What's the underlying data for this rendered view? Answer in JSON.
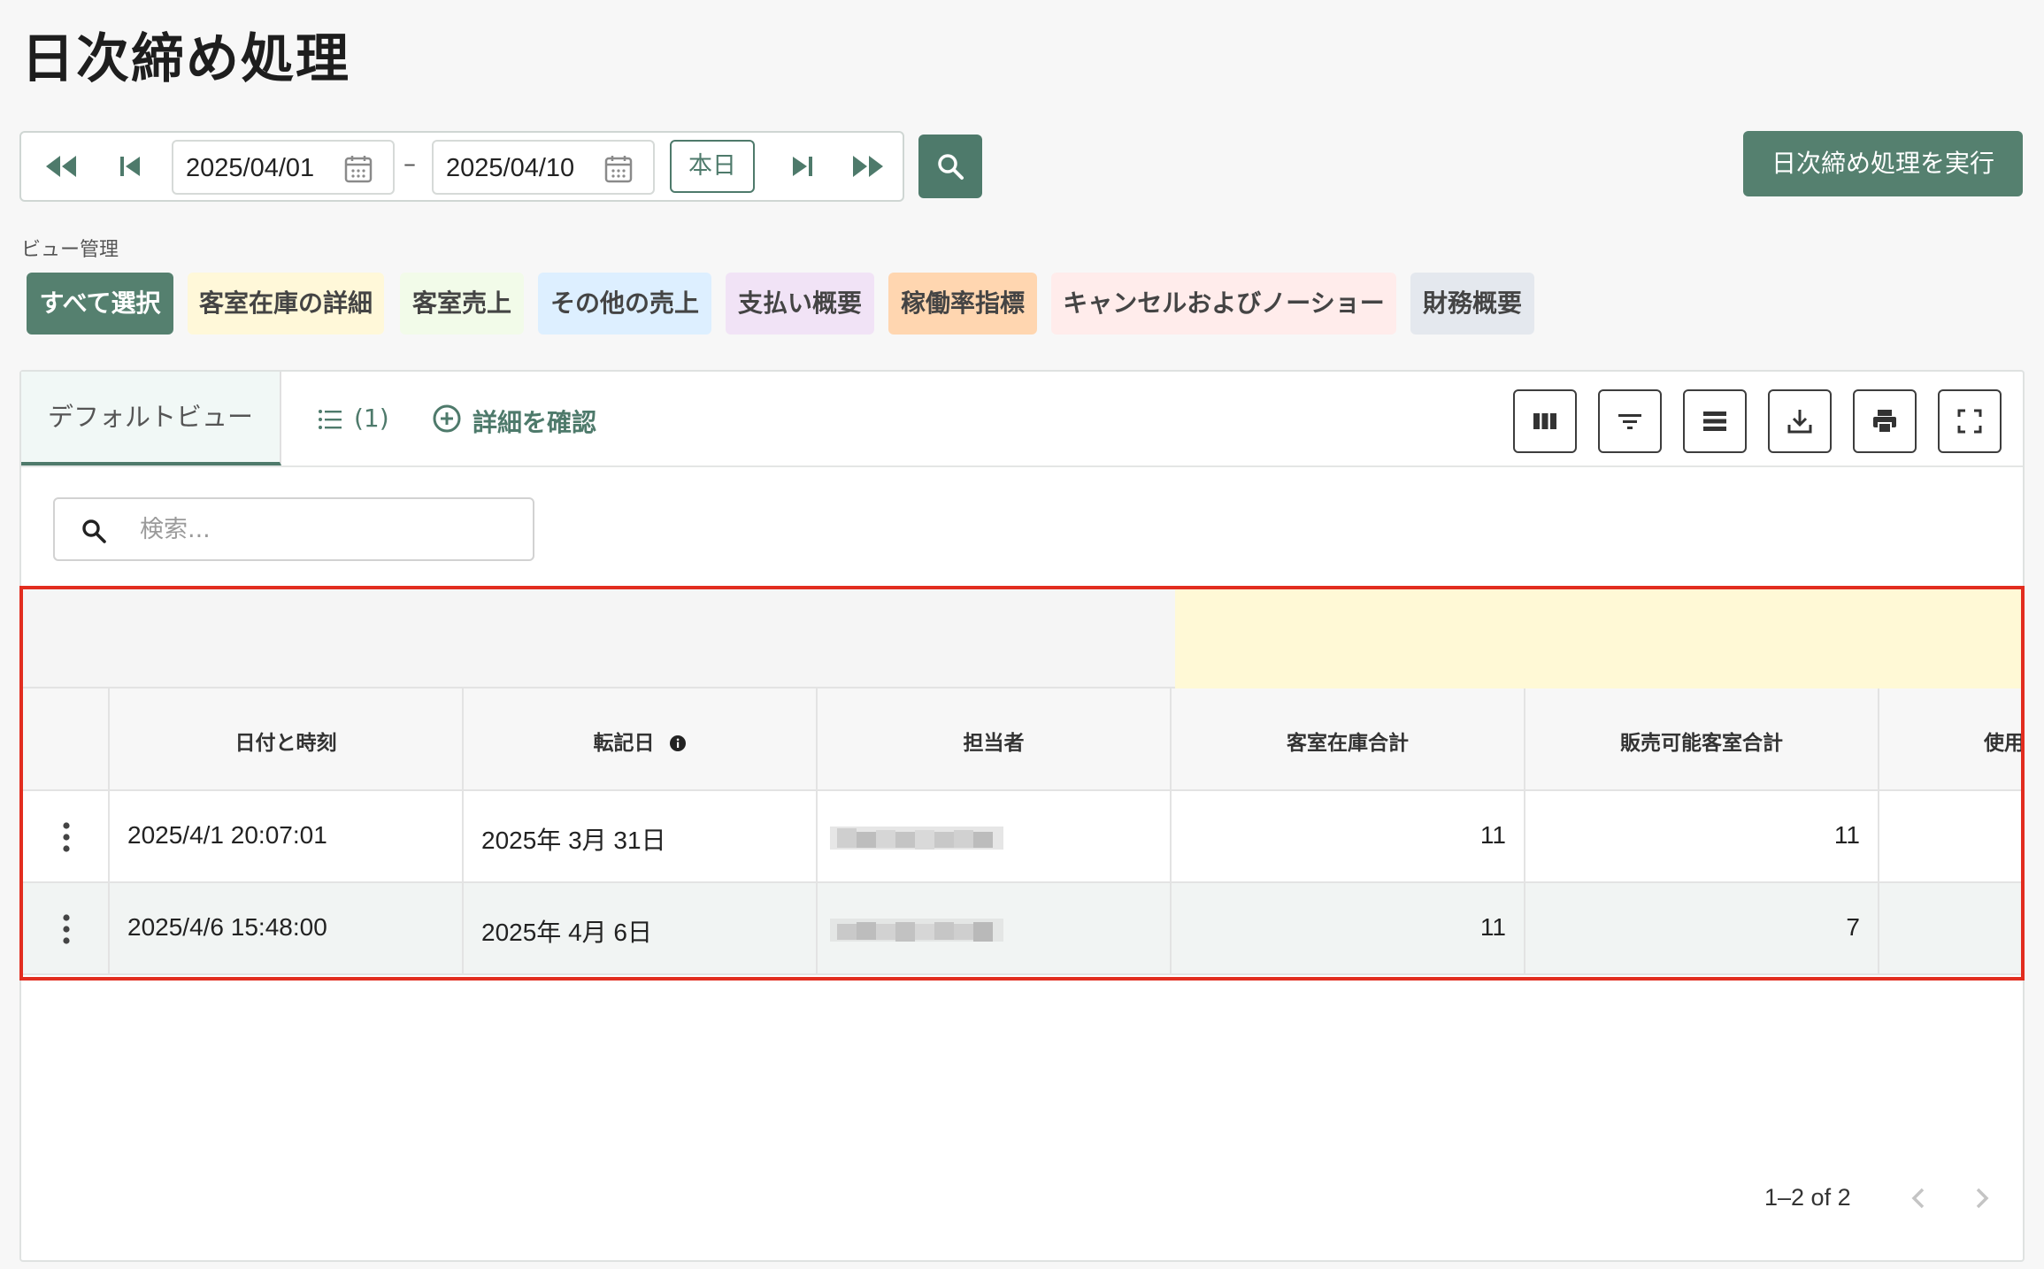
{
  "page": {
    "title": "日次締め処理"
  },
  "date_range": {
    "start": "2025/04/01",
    "separator": "–",
    "end": "2025/04/10",
    "today_label": "本日"
  },
  "actions": {
    "execute_label": "日次締め処理を実行"
  },
  "view_management": {
    "label": "ビュー管理",
    "chips": [
      {
        "label": "すべて選択",
        "bg": "#55806f",
        "fg": "#ffffff"
      },
      {
        "label": "客室在庫の詳細",
        "bg": "#fff8d9",
        "fg": "#444444"
      },
      {
        "label": "客室売上",
        "bg": "#f2fbe9",
        "fg": "#444444"
      },
      {
        "label": "その他の売上",
        "bg": "#ddefff",
        "fg": "#444444"
      },
      {
        "label": "支払い概要",
        "bg": "#f1e3f6",
        "fg": "#444444"
      },
      {
        "label": "稼働率指標",
        "bg": "#ffd6b0",
        "fg": "#444444"
      },
      {
        "label": "キャンセルおよびノーショー",
        "bg": "#ffeceb",
        "fg": "#444444"
      },
      {
        "label": "財務概要",
        "bg": "#e4e8ee",
        "fg": "#444444"
      }
    ]
  },
  "tabs": {
    "default_view": "デフォルトビュー",
    "list_count": "(1)",
    "details": "詳細を確認"
  },
  "search": {
    "placeholder": "検索..."
  },
  "table": {
    "columns": [
      "日付と時刻",
      "転記日",
      "担当者",
      "客室在庫合計",
      "販売可能客室合計",
      "使用"
    ],
    "info_icon": "info-icon",
    "rows": [
      {
        "datetime": "2025/4/1 20:07:01",
        "posting_date": "2025年 3月 31日",
        "staff": "",
        "inventory_total": "11",
        "sellable_total": "11"
      },
      {
        "datetime": "2025/4/6 15:48:00",
        "posting_date": "2025年 4月 6日",
        "staff": "",
        "inventory_total": "11",
        "sellable_total": "7"
      }
    ]
  },
  "pagination": {
    "text": "1–2 of 2"
  },
  "colors": {
    "accent": "#4e7a6b",
    "highlight_frame": "#e22d1f",
    "group_header_yellow": "#fff9d6"
  }
}
